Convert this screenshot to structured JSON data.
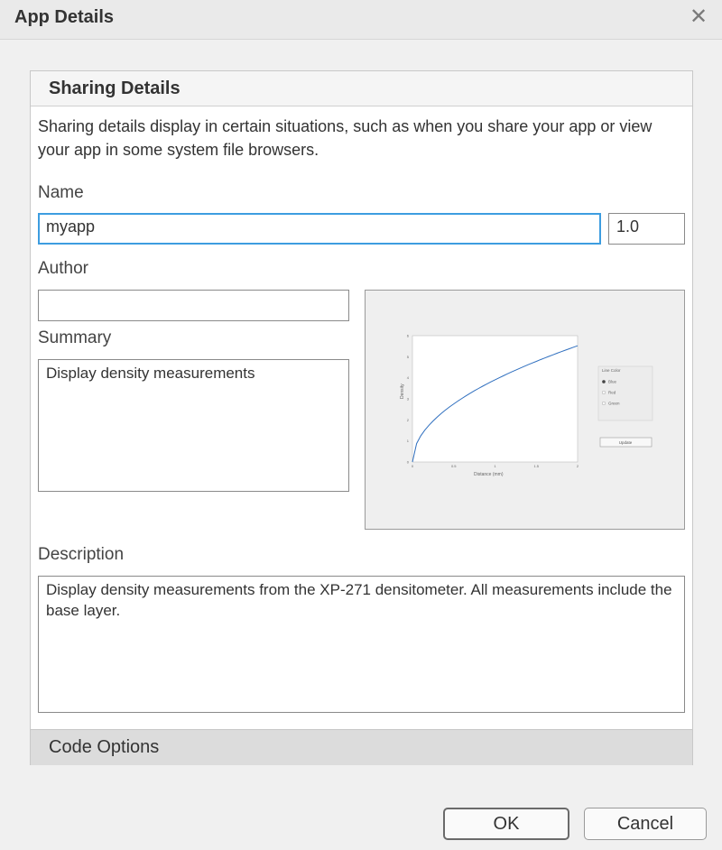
{
  "window": {
    "title": "App Details",
    "close_glyph": "✕"
  },
  "sharing": {
    "header": "Sharing Details",
    "intro": "Sharing details display in certain situations, such as when you share your app or view your app in some system file browsers.",
    "name_label": "Name",
    "name_value": "myapp",
    "version_value": "1.0",
    "author_label": "Author",
    "author_value": "",
    "summary_label": "Summary",
    "summary_value": "Display density measurements",
    "description_label": "Description",
    "description_value": "Display density measurements from the XP-271 densitometer. All measurements include the base layer."
  },
  "code_options": {
    "label": "Code Options"
  },
  "buttons": {
    "ok": "OK",
    "cancel": "Cancel"
  },
  "preview_app": {
    "ylabel": "Density",
    "xlabel": "Distance (mm)",
    "yticks": [
      "0",
      "1",
      "2",
      "3",
      "4",
      "5",
      "6"
    ],
    "xticks": [
      "0",
      "0.5",
      "1",
      "1.5",
      "2"
    ],
    "color_group_label": "Line Color",
    "color_options": [
      "Blue",
      "Red",
      "Green"
    ],
    "selected_color": "Blue",
    "update_button": "Update"
  },
  "colors": {
    "focus": "#3d9de0",
    "curve": "#2f6fbf"
  }
}
